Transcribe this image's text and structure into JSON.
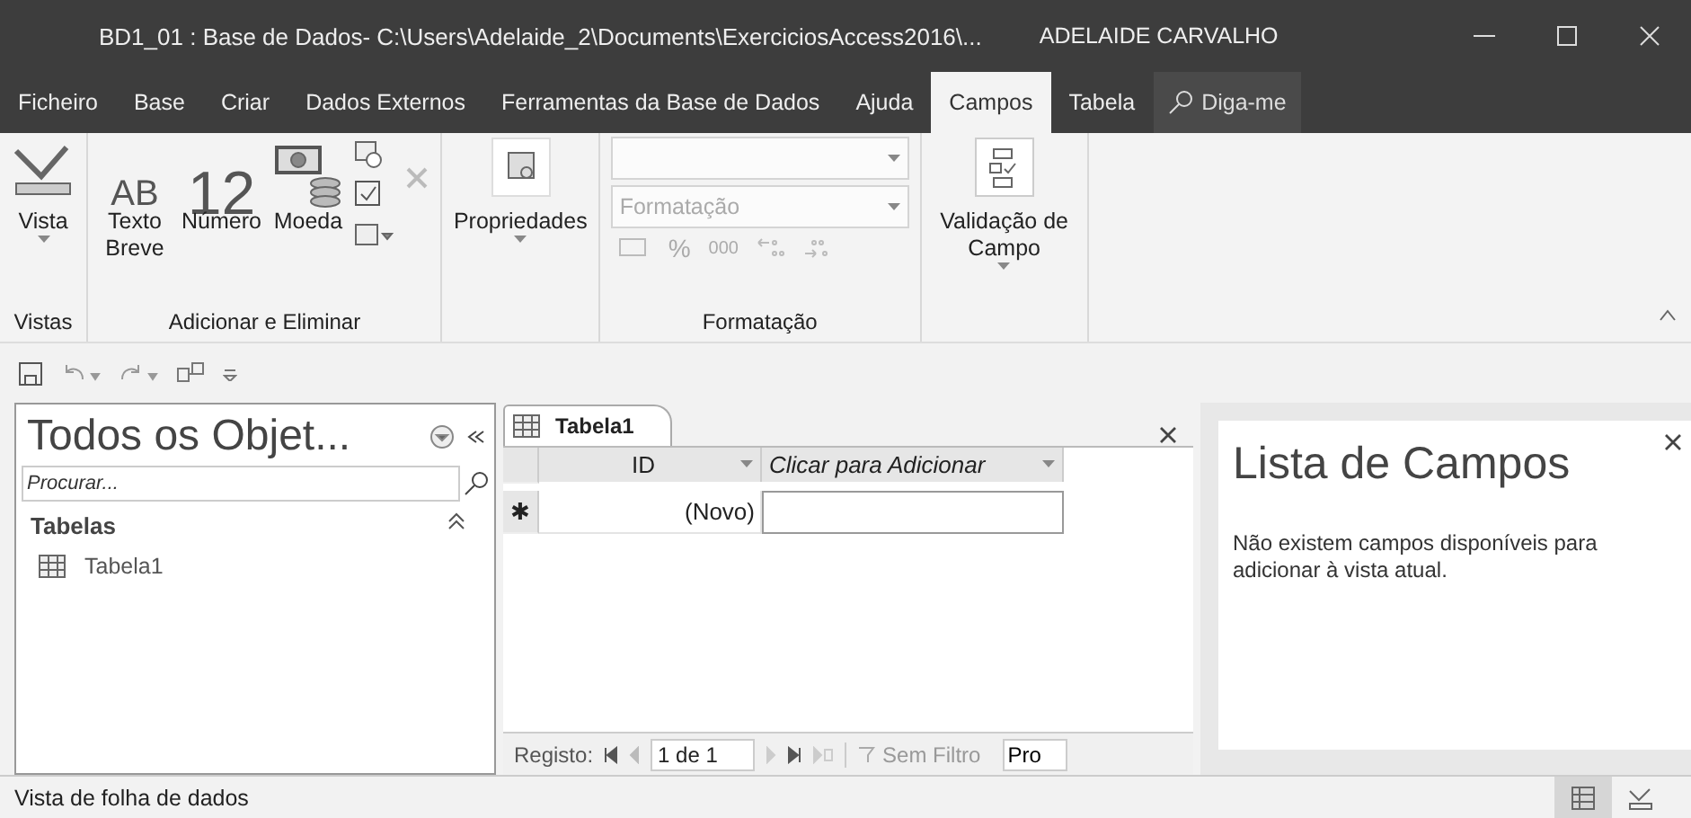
{
  "window": {
    "title": "BD1_01 : Base de Dados- C:\\Users\\Adelaide_2\\Documents\\ExerciciosAccess2016\\...",
    "user": "ADELAIDE CARVALHO"
  },
  "ribbon_tabs": [
    {
      "label": "Ficheiro",
      "selected": false
    },
    {
      "label": "Base",
      "selected": false
    },
    {
      "label": "Criar",
      "selected": false
    },
    {
      "label": "Dados Externos",
      "selected": false
    },
    {
      "label": "Ferramentas da Base de Dados",
      "selected": false
    },
    {
      "label": "Ajuda",
      "selected": false
    },
    {
      "label": "Campos",
      "selected": true
    },
    {
      "label": "Tabela",
      "selected": false
    }
  ],
  "tell_me": {
    "placeholder": "Diga-me"
  },
  "ribbon": {
    "vista": {
      "label": "Vista",
      "group": "Vistas"
    },
    "add_delete": {
      "group": "Adicionar e Eliminar",
      "buttons": [
        {
          "kind": "text",
          "glyph": "AB",
          "label": "Texto Breve"
        },
        {
          "kind": "number",
          "glyph": "12",
          "label": "Número"
        },
        {
          "kind": "currency",
          "label": "Moeda"
        }
      ]
    },
    "properties": {
      "label": "Propriedades"
    },
    "formatting": {
      "group": "Formatação",
      "format_placeholder": "Formatação",
      "percent": "%",
      "thousands": "000"
    },
    "validation": {
      "label": "Validação de Campo"
    }
  },
  "nav_pane": {
    "title": "Todos os Objet...",
    "search": {
      "placeholder": "Procurar..."
    },
    "group": "Tabelas",
    "items": [
      {
        "label": "Tabela1",
        "selected": false
      }
    ]
  },
  "datasheet": {
    "tab": "Tabela1",
    "columns": [
      "ID",
      "Clicar para Adicionar"
    ],
    "new_row_marker": "✱",
    "new_row_value": "(Novo)",
    "record_nav": {
      "label": "Registo:",
      "position": "1 de 1",
      "filter": "Sem Filtro",
      "search": "Pro"
    }
  },
  "field_list": {
    "title": "Lista de Campos",
    "message": "Não existem campos disponíveis para adicionar à vista atual."
  },
  "status_bar": {
    "text": "Vista de folha de dados",
    "views": [
      {
        "kind": "datasheet",
        "selected": true
      },
      {
        "kind": "design",
        "selected": false
      }
    ]
  }
}
